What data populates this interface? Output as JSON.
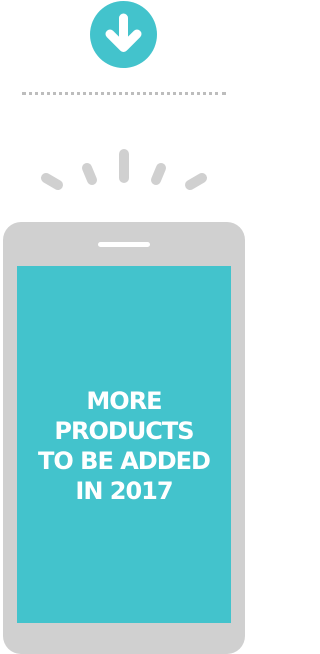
{
  "download_button": {
    "icon": "arrow-down-icon",
    "color": "#43c3cc"
  },
  "phone": {
    "screen_color": "#43c3cc",
    "body_color": "#d0d0d0",
    "message": "MORE\nPRODUCTS\nTO BE ADDED\nIN 2017"
  },
  "decor": {
    "divider_color": "#bdbdbd",
    "rays_color": "#d0d0d0"
  }
}
